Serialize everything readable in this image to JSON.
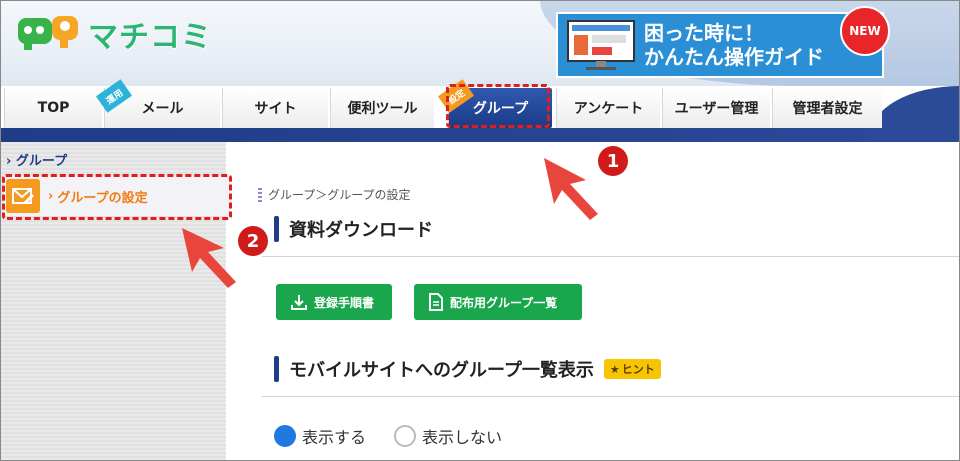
{
  "header": {
    "logo_text": "マチコミ",
    "guide_banner": {
      "line1": "困った時に！",
      "line2": "かんたん操作ガイド",
      "badge": "NEW"
    }
  },
  "nav": {
    "tabs": [
      {
        "label": "TOP"
      },
      {
        "label": "メール",
        "ribbon": "運用"
      },
      {
        "label": "サイト"
      },
      {
        "label": "便利ツール"
      },
      {
        "label": "グループ",
        "ribbon": "設定",
        "active": true
      },
      {
        "label": "アンケート"
      },
      {
        "label": "ユーザー管理"
      },
      {
        "label": "管理者設定"
      }
    ]
  },
  "sidebar": {
    "heading": "グループ",
    "item_label": "グループの設定"
  },
  "main": {
    "breadcrumb": "グループ＞グループの設定",
    "section1_title": "資料ダウンロード",
    "buttons": {
      "register_manual": "登録手順書",
      "distribution_list": "配布用グループ一覧"
    },
    "section2_title": "モバイルサイトへのグループ一覧表示",
    "hint_label": "ヒント",
    "radio": {
      "show": "表示する",
      "hide": "表示しない",
      "selected": "show"
    }
  },
  "annotations": {
    "marker1": "1",
    "marker2": "2"
  },
  "colors": {
    "accent_blue": "#1f3d86",
    "active_tab": "#2f5ab0",
    "green": "#1aa64c",
    "orange": "#f07d14",
    "annotation_red": "#d11b1b"
  }
}
